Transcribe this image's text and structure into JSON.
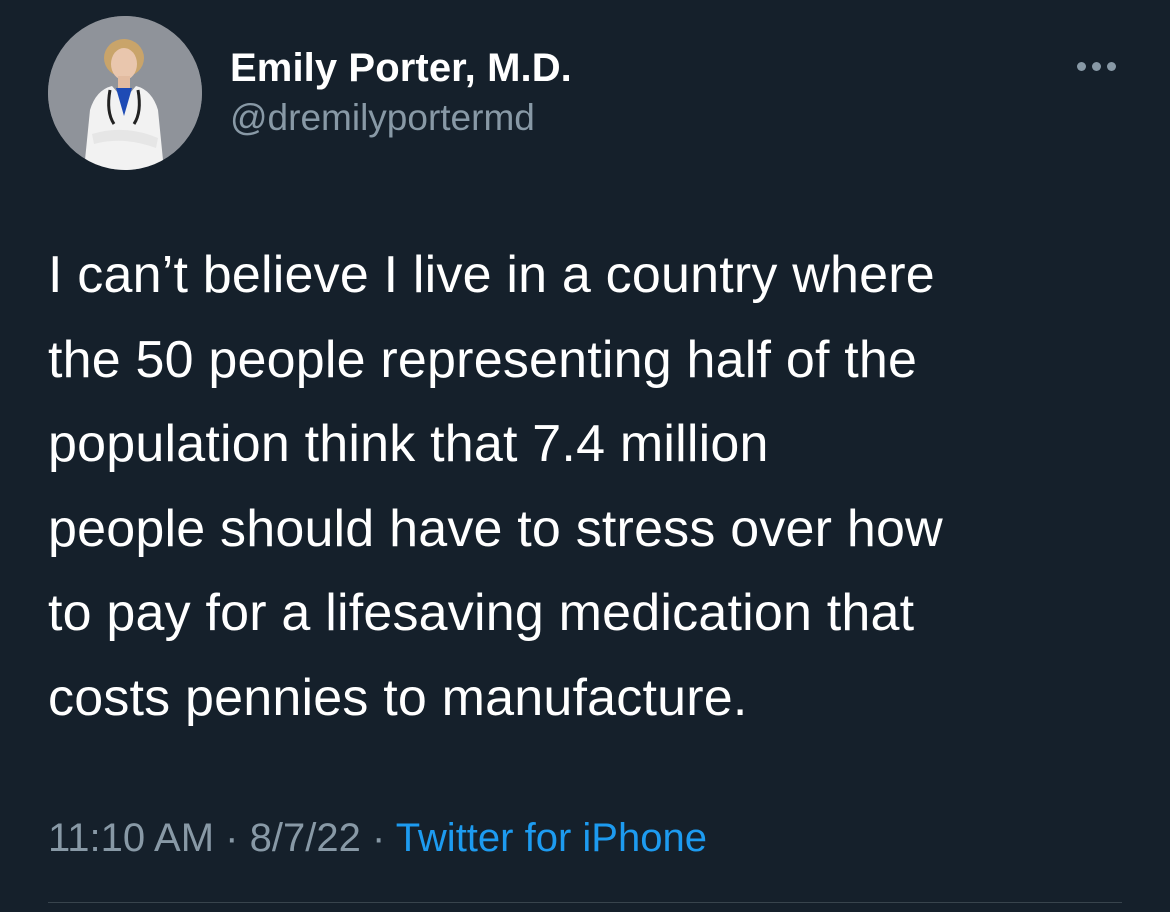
{
  "tweet": {
    "author": {
      "display_name": "Emily Porter, M.D.",
      "handle": "@dremilyportermd",
      "avatar_icon": "profile-photo"
    },
    "more_icon": "more-horizontal-icon",
    "text": "I can’t believe I live in a country where\nthe 50 people representing half of the\npopulation think that 7.4 million\npeople should have to stress over how\nto pay for a lifesaving medication that\ncosts pennies to manufacture.",
    "meta": {
      "time": "11:10 AM",
      "separator": "·",
      "date": "8/7/22",
      "source": "Twitter for iPhone"
    }
  },
  "colors": {
    "background": "#15202b",
    "primary_text": "#ffffff",
    "secondary_text": "#8899a6",
    "link": "#1d9bf0",
    "divider": "#38444d"
  }
}
